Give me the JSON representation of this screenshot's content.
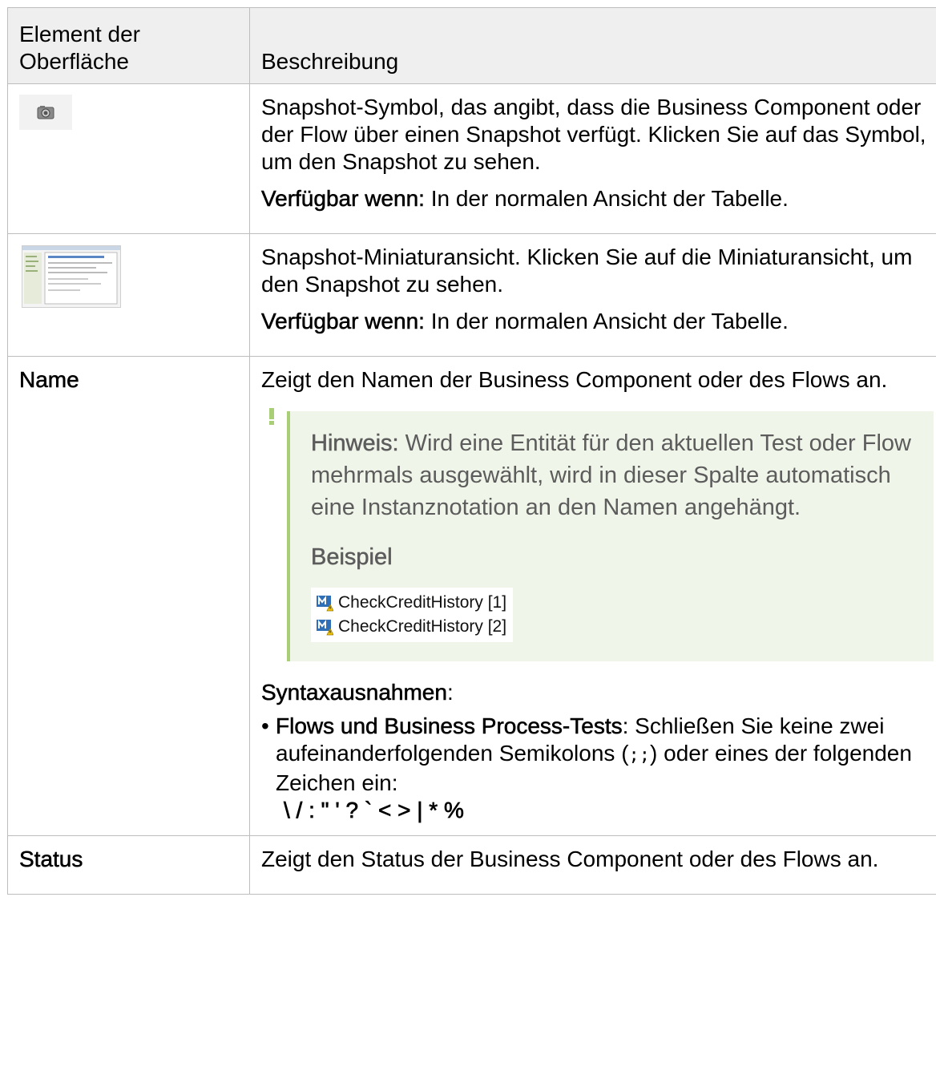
{
  "table": {
    "header": {
      "col1": "Element der Oberfläche",
      "col2": "Beschreibung"
    },
    "rows": {
      "snapshot_icon": {
        "icon": "camera-icon",
        "desc": "Snapshot-Symbol, das angibt, dass die Business Component oder der Flow über einen Snapshot verfügt. Klicken Sie auf das Symbol, um den Snapshot zu sehen.",
        "avail_label": "Verfügbar wenn:",
        "avail_text": " In der normalen Ansicht der Tabelle."
      },
      "snapshot_thumb": {
        "icon": "snapshot-thumbnail",
        "desc": "Snapshot-Miniaturansicht. Klicken Sie auf die Miniaturansicht, um den Snapshot zu sehen.",
        "avail_label": "Verfügbar wenn:",
        "avail_text": " In der normalen Ansicht der Tabelle."
      },
      "name": {
        "label": "Name",
        "desc": "Zeigt den Namen der Business Component oder des Flows an.",
        "note": {
          "title": "Hinweis:",
          "text": " Wird eine Entität für den aktuellen Test oder Flow mehrmals ausgewählt, wird in dieser Spalte automatisch eine Instanznotation an den Namen angehängt.",
          "example_title": "Beispiel",
          "examples": [
            "CheckCreditHistory [1]",
            "CheckCreditHistory [2]"
          ]
        },
        "syntax_label": "Syntaxausnahmen",
        "syntax_colon": ":",
        "bullet_label": "Flows und Business Process-Tests",
        "bullet_text_a": ": Schließen Sie keine zwei aufeinanderfolgenden Semikolons (",
        "bullet_code": ";;",
        "bullet_text_b": ") oder eines der folgenden Zeichen ein:",
        "bullet_chars": "\\ / : \" ' ? ` < > | * %"
      },
      "status": {
        "label": "Status",
        "desc": "Zeigt den Status der Business Component oder des Flows an."
      }
    }
  }
}
